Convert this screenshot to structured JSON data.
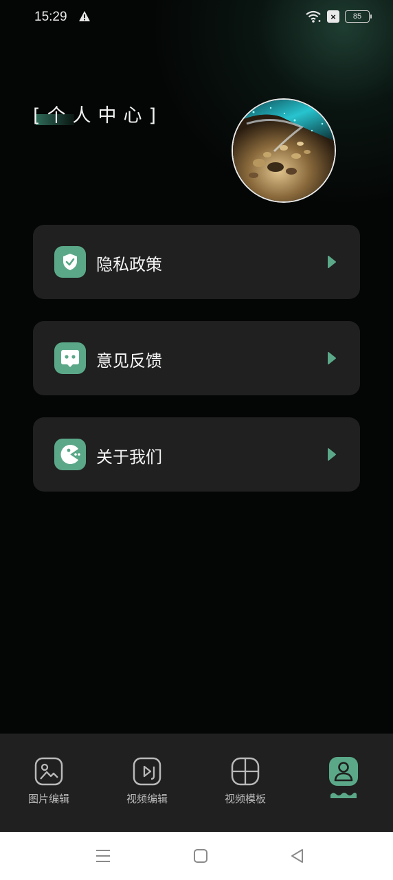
{
  "status_bar": {
    "time": "15:29",
    "battery": "85",
    "icons": [
      "alert-icon",
      "wifi-icon",
      "sim-x-icon",
      "battery-icon"
    ]
  },
  "header": {
    "title": "[个人中心]"
  },
  "menu": [
    {
      "label": "隐私政策",
      "icon": "shield-check-icon"
    },
    {
      "label": "意见反馈",
      "icon": "chat-bubble-icon"
    },
    {
      "label": "关于我们",
      "icon": "pacman-icon"
    }
  ],
  "bottom_nav": [
    {
      "label": "图片编辑",
      "icon": "image-icon",
      "active": false
    },
    {
      "label": "视频编辑",
      "icon": "video-play-icon",
      "active": false
    },
    {
      "label": "视频模板",
      "icon": "template-grid-icon",
      "active": false
    },
    {
      "label": "",
      "icon": "user-icon",
      "active": true
    }
  ],
  "colors": {
    "accent": "#5ba889",
    "card": "#1f201f",
    "background": "#040605"
  }
}
